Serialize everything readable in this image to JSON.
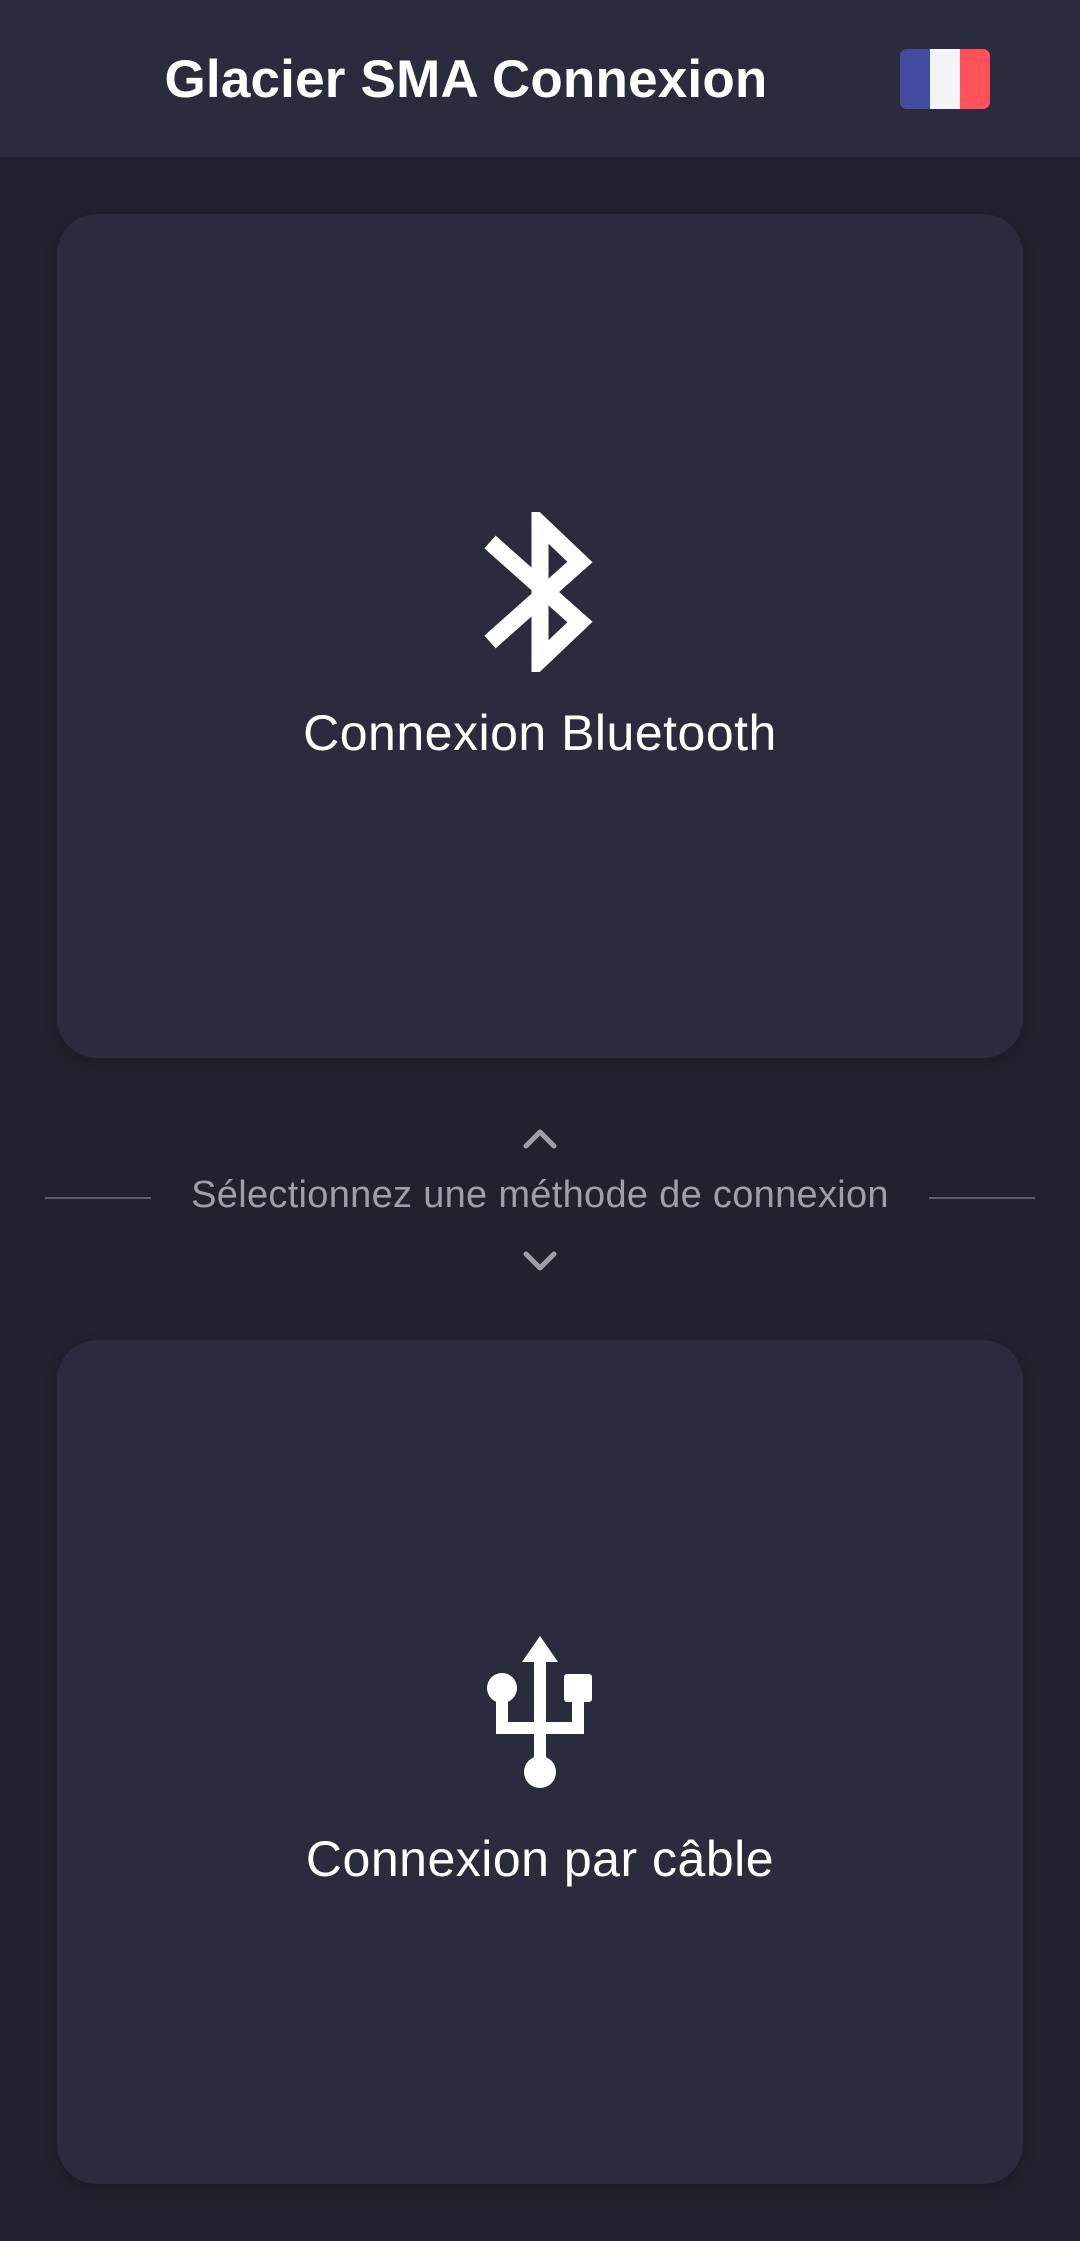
{
  "app_bar": {
    "title": "Glacier SMA Connexion",
    "language_flag": {
      "icon": "france-flag-icon",
      "colors": [
        "#454ca0",
        "#f4f4f6",
        "#ff535b"
      ]
    }
  },
  "bluetooth_card": {
    "icon": "bluetooth-icon",
    "label": "Connexion Bluetooth"
  },
  "divider": {
    "text": "Sélectionnez une méthode de connexion",
    "up_icon": "chevron-up-icon",
    "down_icon": "chevron-down-icon"
  },
  "usb_card": {
    "icon": "usb-icon",
    "label": "Connexion par câble"
  },
  "colors": {
    "background": "#21222f",
    "surface": "#2a2c3d",
    "text_primary": "#ffffff",
    "text_secondary": "#9d9fab"
  }
}
